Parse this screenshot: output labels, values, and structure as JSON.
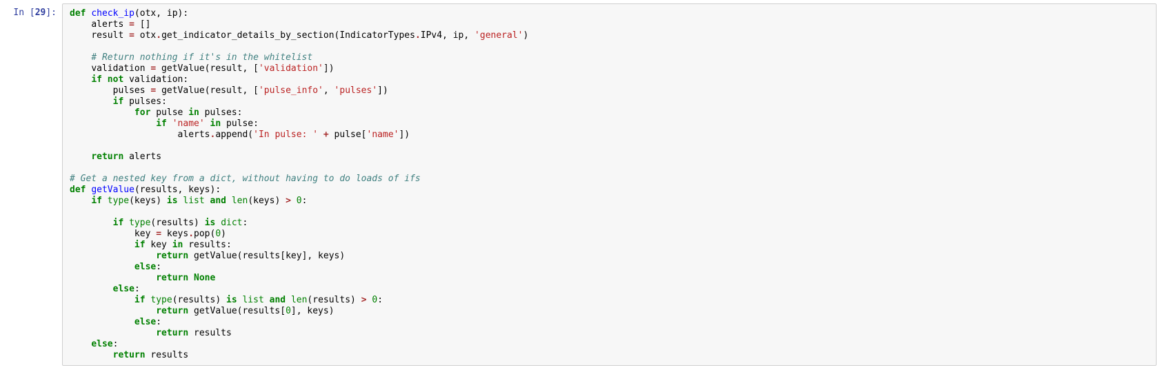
{
  "prompt": {
    "in_label": "In ",
    "number": "29",
    "bracket_open": "[",
    "bracket_close": "]:"
  },
  "lines": [
    {
      "indent": 0,
      "tokens": [
        {
          "c": "kw",
          "t": "def"
        },
        {
          "c": "",
          "t": " "
        },
        {
          "c": "fn",
          "t": "check_ip"
        },
        {
          "c": "",
          "t": "(otx, ip):"
        }
      ]
    },
    {
      "indent": 1,
      "tokens": [
        {
          "c": "",
          "t": "alerts "
        },
        {
          "c": "op",
          "t": "="
        },
        {
          "c": "",
          "t": " []"
        }
      ]
    },
    {
      "indent": 1,
      "tokens": [
        {
          "c": "",
          "t": "result "
        },
        {
          "c": "op",
          "t": "="
        },
        {
          "c": "",
          "t": " otx"
        },
        {
          "c": "op",
          "t": "."
        },
        {
          "c": "",
          "t": "get_indicator_details_by_section(IndicatorTypes"
        },
        {
          "c": "op",
          "t": "."
        },
        {
          "c": "",
          "t": "IPv4, ip, "
        },
        {
          "c": "str",
          "t": "'general'"
        },
        {
          "c": "",
          "t": ")"
        }
      ]
    },
    {
      "indent": 0,
      "tokens": []
    },
    {
      "indent": 1,
      "tokens": [
        {
          "c": "cmt",
          "t": "# Return nothing if it's in the whitelist"
        }
      ]
    },
    {
      "indent": 1,
      "tokens": [
        {
          "c": "",
          "t": "validation "
        },
        {
          "c": "op",
          "t": "="
        },
        {
          "c": "",
          "t": " getValue(result, ["
        },
        {
          "c": "str",
          "t": "'validation'"
        },
        {
          "c": "",
          "t": "])"
        }
      ]
    },
    {
      "indent": 1,
      "tokens": [
        {
          "c": "kw",
          "t": "if"
        },
        {
          "c": "",
          "t": " "
        },
        {
          "c": "kw",
          "t": "not"
        },
        {
          "c": "",
          "t": " validation:"
        }
      ]
    },
    {
      "indent": 2,
      "tokens": [
        {
          "c": "",
          "t": "pulses "
        },
        {
          "c": "op",
          "t": "="
        },
        {
          "c": "",
          "t": " getValue(result, ["
        },
        {
          "c": "str",
          "t": "'pulse_info'"
        },
        {
          "c": "",
          "t": ", "
        },
        {
          "c": "str",
          "t": "'pulses'"
        },
        {
          "c": "",
          "t": "])"
        }
      ]
    },
    {
      "indent": 2,
      "tokens": [
        {
          "c": "kw",
          "t": "if"
        },
        {
          "c": "",
          "t": " pulses:"
        }
      ]
    },
    {
      "indent": 3,
      "tokens": [
        {
          "c": "kw",
          "t": "for"
        },
        {
          "c": "",
          "t": " pulse "
        },
        {
          "c": "kw",
          "t": "in"
        },
        {
          "c": "",
          "t": " pulses:"
        }
      ]
    },
    {
      "indent": 4,
      "tokens": [
        {
          "c": "kw",
          "t": "if"
        },
        {
          "c": "",
          "t": " "
        },
        {
          "c": "str",
          "t": "'name'"
        },
        {
          "c": "",
          "t": " "
        },
        {
          "c": "kw",
          "t": "in"
        },
        {
          "c": "",
          "t": " pulse:"
        }
      ]
    },
    {
      "indent": 5,
      "tokens": [
        {
          "c": "",
          "t": "alerts"
        },
        {
          "c": "op",
          "t": "."
        },
        {
          "c": "",
          "t": "append("
        },
        {
          "c": "str",
          "t": "'In pulse: '"
        },
        {
          "c": "",
          "t": " "
        },
        {
          "c": "op",
          "t": "+"
        },
        {
          "c": "",
          "t": " pulse["
        },
        {
          "c": "str",
          "t": "'name'"
        },
        {
          "c": "",
          "t": "])"
        }
      ]
    },
    {
      "indent": 0,
      "tokens": []
    },
    {
      "indent": 1,
      "tokens": [
        {
          "c": "kw",
          "t": "return"
        },
        {
          "c": "",
          "t": " alerts"
        }
      ]
    },
    {
      "indent": 0,
      "tokens": []
    },
    {
      "indent": 0,
      "tokens": [
        {
          "c": "cmt",
          "t": "# Get a nested key from a dict, without having to do loads of ifs"
        }
      ]
    },
    {
      "indent": 0,
      "tokens": [
        {
          "c": "kw",
          "t": "def"
        },
        {
          "c": "",
          "t": " "
        },
        {
          "c": "fn",
          "t": "getValue"
        },
        {
          "c": "",
          "t": "(results, keys):"
        }
      ]
    },
    {
      "indent": 1,
      "tokens": [
        {
          "c": "kw",
          "t": "if"
        },
        {
          "c": "",
          "t": " "
        },
        {
          "c": "blt",
          "t": "type"
        },
        {
          "c": "",
          "t": "(keys) "
        },
        {
          "c": "kw",
          "t": "is"
        },
        {
          "c": "",
          "t": " "
        },
        {
          "c": "blt",
          "t": "list"
        },
        {
          "c": "",
          "t": " "
        },
        {
          "c": "kw",
          "t": "and"
        },
        {
          "c": "",
          "t": " "
        },
        {
          "c": "blt",
          "t": "len"
        },
        {
          "c": "",
          "t": "(keys) "
        },
        {
          "c": "op",
          "t": ">"
        },
        {
          "c": "",
          "t": " "
        },
        {
          "c": "num",
          "t": "0"
        },
        {
          "c": "",
          "t": ":"
        }
      ]
    },
    {
      "indent": 0,
      "tokens": []
    },
    {
      "indent": 2,
      "tokens": [
        {
          "c": "kw",
          "t": "if"
        },
        {
          "c": "",
          "t": " "
        },
        {
          "c": "blt",
          "t": "type"
        },
        {
          "c": "",
          "t": "(results) "
        },
        {
          "c": "kw",
          "t": "is"
        },
        {
          "c": "",
          "t": " "
        },
        {
          "c": "blt",
          "t": "dict"
        },
        {
          "c": "",
          "t": ":"
        }
      ]
    },
    {
      "indent": 3,
      "tokens": [
        {
          "c": "",
          "t": "key "
        },
        {
          "c": "op",
          "t": "="
        },
        {
          "c": "",
          "t": " keys"
        },
        {
          "c": "op",
          "t": "."
        },
        {
          "c": "",
          "t": "pop("
        },
        {
          "c": "num",
          "t": "0"
        },
        {
          "c": "",
          "t": ")"
        }
      ]
    },
    {
      "indent": 3,
      "tokens": [
        {
          "c": "kw",
          "t": "if"
        },
        {
          "c": "",
          "t": " key "
        },
        {
          "c": "kw",
          "t": "in"
        },
        {
          "c": "",
          "t": " results:"
        }
      ]
    },
    {
      "indent": 4,
      "tokens": [
        {
          "c": "kw",
          "t": "return"
        },
        {
          "c": "",
          "t": " getValue(results[key], keys)"
        }
      ]
    },
    {
      "indent": 3,
      "tokens": [
        {
          "c": "kw",
          "t": "else"
        },
        {
          "c": "",
          "t": ":"
        }
      ]
    },
    {
      "indent": 4,
      "tokens": [
        {
          "c": "kw",
          "t": "return"
        },
        {
          "c": "",
          "t": " "
        },
        {
          "c": "kw2",
          "t": "None"
        }
      ]
    },
    {
      "indent": 2,
      "tokens": [
        {
          "c": "kw",
          "t": "else"
        },
        {
          "c": "",
          "t": ":"
        }
      ]
    },
    {
      "indent": 3,
      "tokens": [
        {
          "c": "kw",
          "t": "if"
        },
        {
          "c": "",
          "t": " "
        },
        {
          "c": "blt",
          "t": "type"
        },
        {
          "c": "",
          "t": "(results) "
        },
        {
          "c": "kw",
          "t": "is"
        },
        {
          "c": "",
          "t": " "
        },
        {
          "c": "blt",
          "t": "list"
        },
        {
          "c": "",
          "t": " "
        },
        {
          "c": "kw",
          "t": "and"
        },
        {
          "c": "",
          "t": " "
        },
        {
          "c": "blt",
          "t": "len"
        },
        {
          "c": "",
          "t": "(results) "
        },
        {
          "c": "op",
          "t": ">"
        },
        {
          "c": "",
          "t": " "
        },
        {
          "c": "num",
          "t": "0"
        },
        {
          "c": "",
          "t": ":"
        }
      ]
    },
    {
      "indent": 4,
      "tokens": [
        {
          "c": "kw",
          "t": "return"
        },
        {
          "c": "",
          "t": " getValue(results["
        },
        {
          "c": "num",
          "t": "0"
        },
        {
          "c": "",
          "t": "], keys)"
        }
      ]
    },
    {
      "indent": 3,
      "tokens": [
        {
          "c": "kw",
          "t": "else"
        },
        {
          "c": "",
          "t": ":"
        }
      ]
    },
    {
      "indent": 4,
      "tokens": [
        {
          "c": "kw",
          "t": "return"
        },
        {
          "c": "",
          "t": " results"
        }
      ]
    },
    {
      "indent": 1,
      "tokens": [
        {
          "c": "kw",
          "t": "else"
        },
        {
          "c": "",
          "t": ":"
        }
      ]
    },
    {
      "indent": 2,
      "tokens": [
        {
          "c": "kw",
          "t": "return"
        },
        {
          "c": "",
          "t": " results"
        }
      ]
    }
  ]
}
